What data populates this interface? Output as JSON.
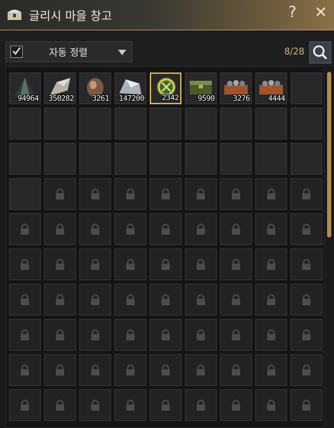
{
  "window": {
    "title": "글리시 마을 창고",
    "help_label": "?",
    "close_label": "✕"
  },
  "toolbar": {
    "auto_sort_label": "자동 정렬",
    "auto_sort_checked": true,
    "slot_count": "8/28"
  },
  "items": [
    {
      "icon": "dark-stone-icon",
      "qty": "94964"
    },
    {
      "icon": "crystal-ore-icon",
      "qty": "350282"
    },
    {
      "icon": "copper-ore-icon",
      "qty": "3261"
    },
    {
      "icon": "silver-ore-icon",
      "qty": "147200"
    },
    {
      "icon": "gold-emblem-icon",
      "qty": "2342",
      "selected": true
    },
    {
      "icon": "green-chest-icon",
      "qty": "9590"
    },
    {
      "icon": "ore-crate-icon",
      "qty": "3276"
    },
    {
      "icon": "ore-crate-icon",
      "qty": "4444"
    }
  ],
  "inventory": {
    "empty_open_slots": 20,
    "total_rows": 10,
    "columns": 9
  },
  "colors": {
    "accent": "#d9b24c",
    "titlebar": "#8a7048",
    "slot": "#28282b"
  }
}
